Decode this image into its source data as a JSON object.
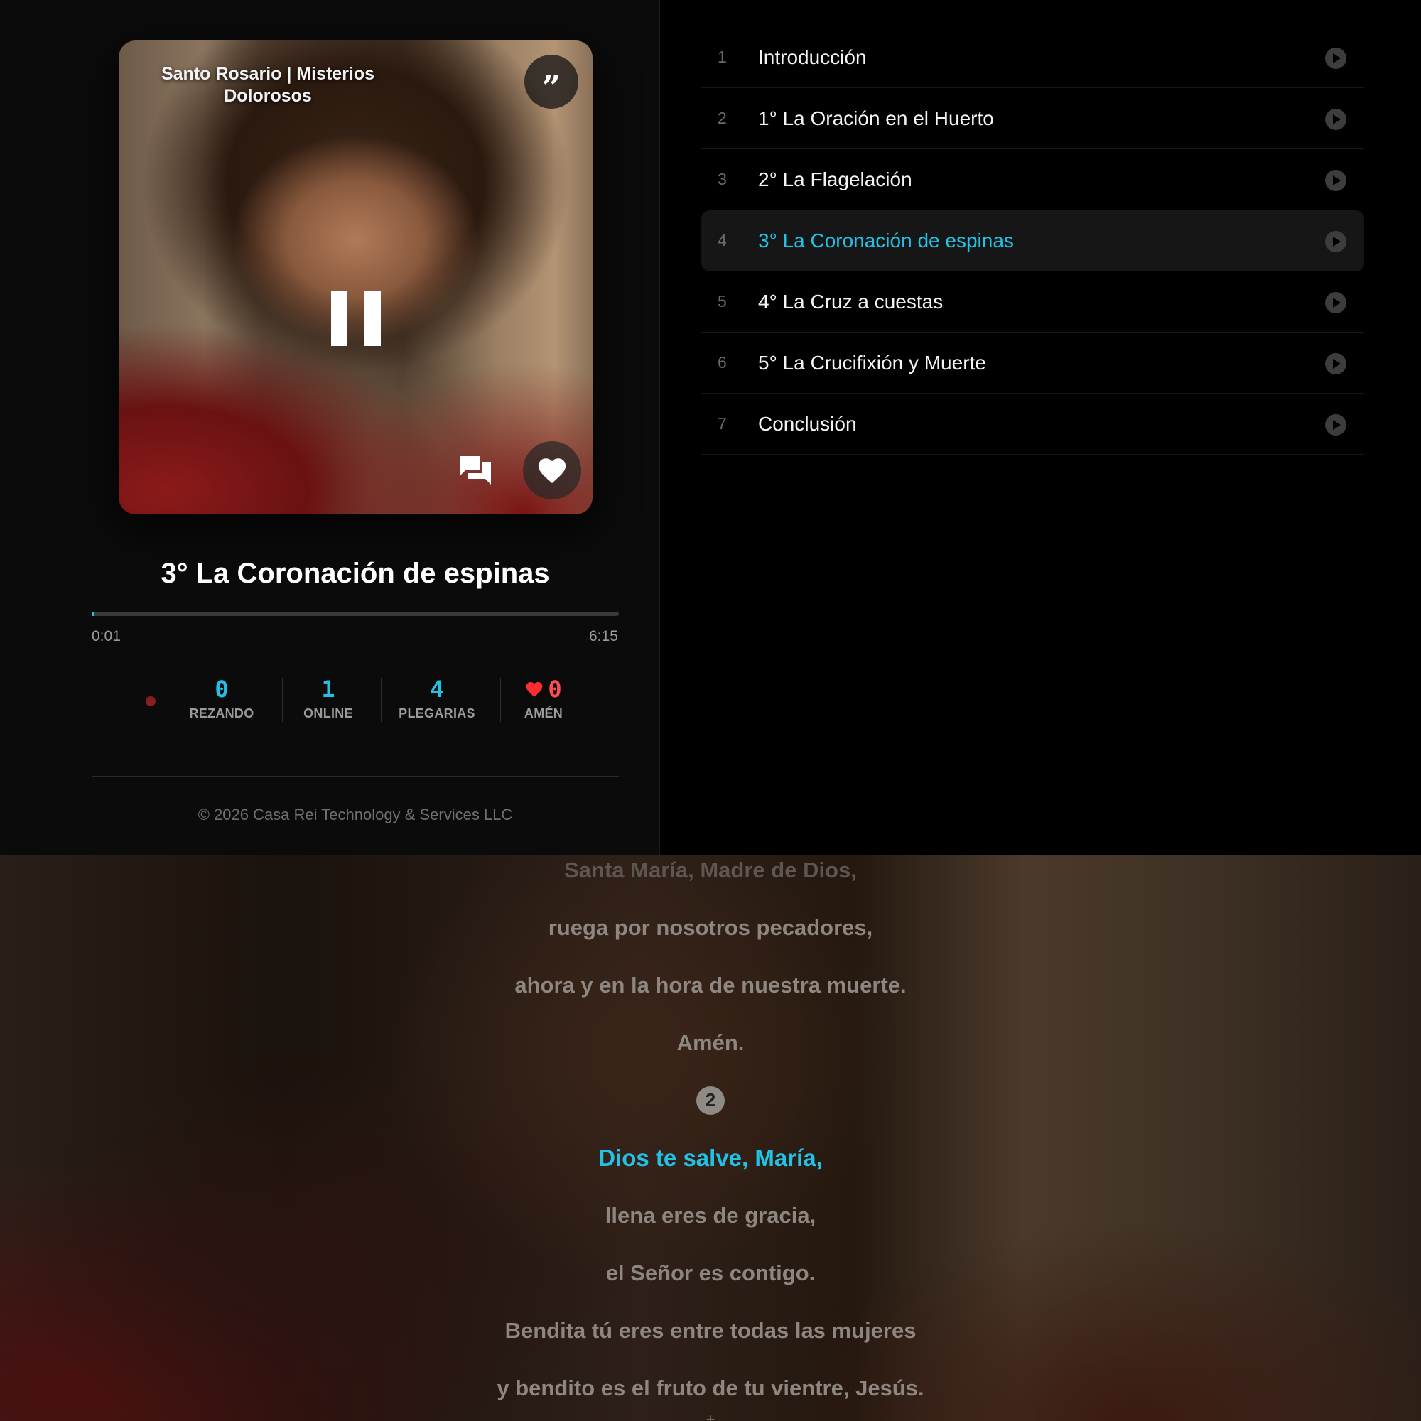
{
  "cover": {
    "title": "Santo Rosario | Misterios Dolorosos",
    "quote_icon": "quote-icon",
    "pause_icon": "pause-icon",
    "comments_icon": "comments-icon",
    "heart_icon": "heart-icon"
  },
  "player": {
    "track_title": "3° La Coronación de espinas",
    "current_time": "0:01",
    "total_time": "6:15",
    "progress_fraction": 0.003
  },
  "stats": {
    "rezando": {
      "value": "0",
      "label": "REZANDO"
    },
    "online": {
      "value": "1",
      "label": "ONLINE"
    },
    "plegarias": {
      "value": "4",
      "label": "PLEGARIAS"
    },
    "amen": {
      "value": "0",
      "label": "AMÉN"
    }
  },
  "footer": {
    "copyright": "© 2026 Casa Rei Technology & Services LLC"
  },
  "tracks": [
    {
      "num": "1",
      "name": "Introducción"
    },
    {
      "num": "2",
      "name": "1° La Oración en el Huerto"
    },
    {
      "num": "3",
      "name": "2° La Flagelación"
    },
    {
      "num": "4",
      "name": "3° La Coronación de espinas",
      "active": true
    },
    {
      "num": "5",
      "name": "4° La Cruz a cuestas"
    },
    {
      "num": "6",
      "name": "5° La Crucifixión y Muerte"
    },
    {
      "num": "7",
      "name": "Conclusión"
    }
  ],
  "lyrics": {
    "partial_line": "Santa María, Madre de Dios,",
    "lines_before": [
      "ruega por nosotros pecadores,",
      "ahora y en la hora de nuestra muerte.",
      "Amén."
    ],
    "badge": "2",
    "current": "Dios te salve, María,",
    "lines_after": [
      "llena eres de gracia,",
      "el Señor es contigo.",
      "Bendita tú eres entre todas las mujeres",
      "y bendito es el fruto de tu vientre, Jesús."
    ],
    "next_marker": "+"
  },
  "colors": {
    "accent": "#22c1e6",
    "amen": "#ff4d4d",
    "background": "#000000"
  }
}
